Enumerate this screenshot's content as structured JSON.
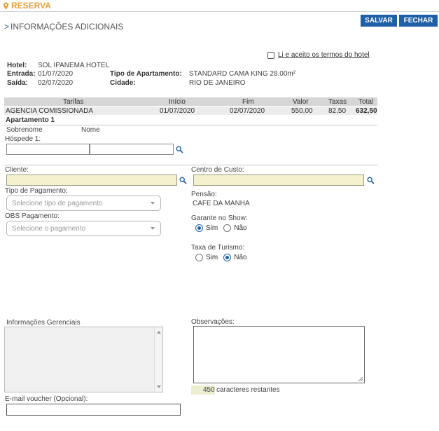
{
  "header": {
    "title": "RESERVA",
    "accent": "#e8a13a"
  },
  "toolbar": {
    "save_label": "SALVAR",
    "close_label": "FECHAR",
    "button_color": "#1f5fa8"
  },
  "section": {
    "arrow": ">",
    "title": "INFORMAÇÕES ADICIONAIS"
  },
  "terms": {
    "label": "Li e aceito os termos do hotel",
    "checked": false
  },
  "booking": {
    "hotel_label": "Hotel:",
    "hotel": "SOL IPANEMA HOTEL",
    "entrada_label": "Entrada:",
    "entrada": "01/07/2020",
    "saida_label": "Saída:",
    "saida": "02/07/2020",
    "tipo_label": "Tipo de Apartamento:",
    "tipo": "STANDARD CAMA KING 28.00m²",
    "cidade_label": "Cidade:",
    "cidade": "RIO DE JANEIRO"
  },
  "rates_table": {
    "headers": [
      "Tarifas",
      "Início",
      "Fim",
      "Valor",
      "Taxas",
      "Total"
    ],
    "rows": [
      {
        "tarifa": "AGENCIA COMISSIONADA",
        "inicio": "01/07/2020",
        "fim": "02/07/2020",
        "valor": "550,00",
        "taxas": "82,50",
        "total": "632,50"
      }
    ]
  },
  "apartment": {
    "title": "Apartamento 1",
    "sobrenome_label": "Sobrenome",
    "nome_label": "Nome",
    "hospede_label": "Hóspede 1:"
  },
  "client": {
    "cliente_label": "Cliente:",
    "centro_label": "Centro de Custo:"
  },
  "payment": {
    "tipo_label": "Tipo de Pagamento:",
    "tipo_placeholder": "Selecione tipo de pagamento",
    "obs_label": "OBS Pagamento:",
    "obs_placeholder": "Selecione o pagamento"
  },
  "pensao": {
    "label": "Pensão:",
    "value": "CAFE DA MANHA"
  },
  "garante": {
    "label": "Garante no Show:",
    "sim": "Sim",
    "nao": "Não",
    "selected": "Sim"
  },
  "taxa_turismo": {
    "label": "Taxa de Turismo:",
    "sim": "Sim",
    "nao": "Não",
    "selected": "Não"
  },
  "gerenciais": {
    "label": "Informações Gerenciais"
  },
  "observacoes": {
    "label": "Observações:",
    "remaining_count": "450",
    "remaining_text": "caracteres restantes"
  },
  "email": {
    "label": "E-mail voucher (Opcional):"
  }
}
